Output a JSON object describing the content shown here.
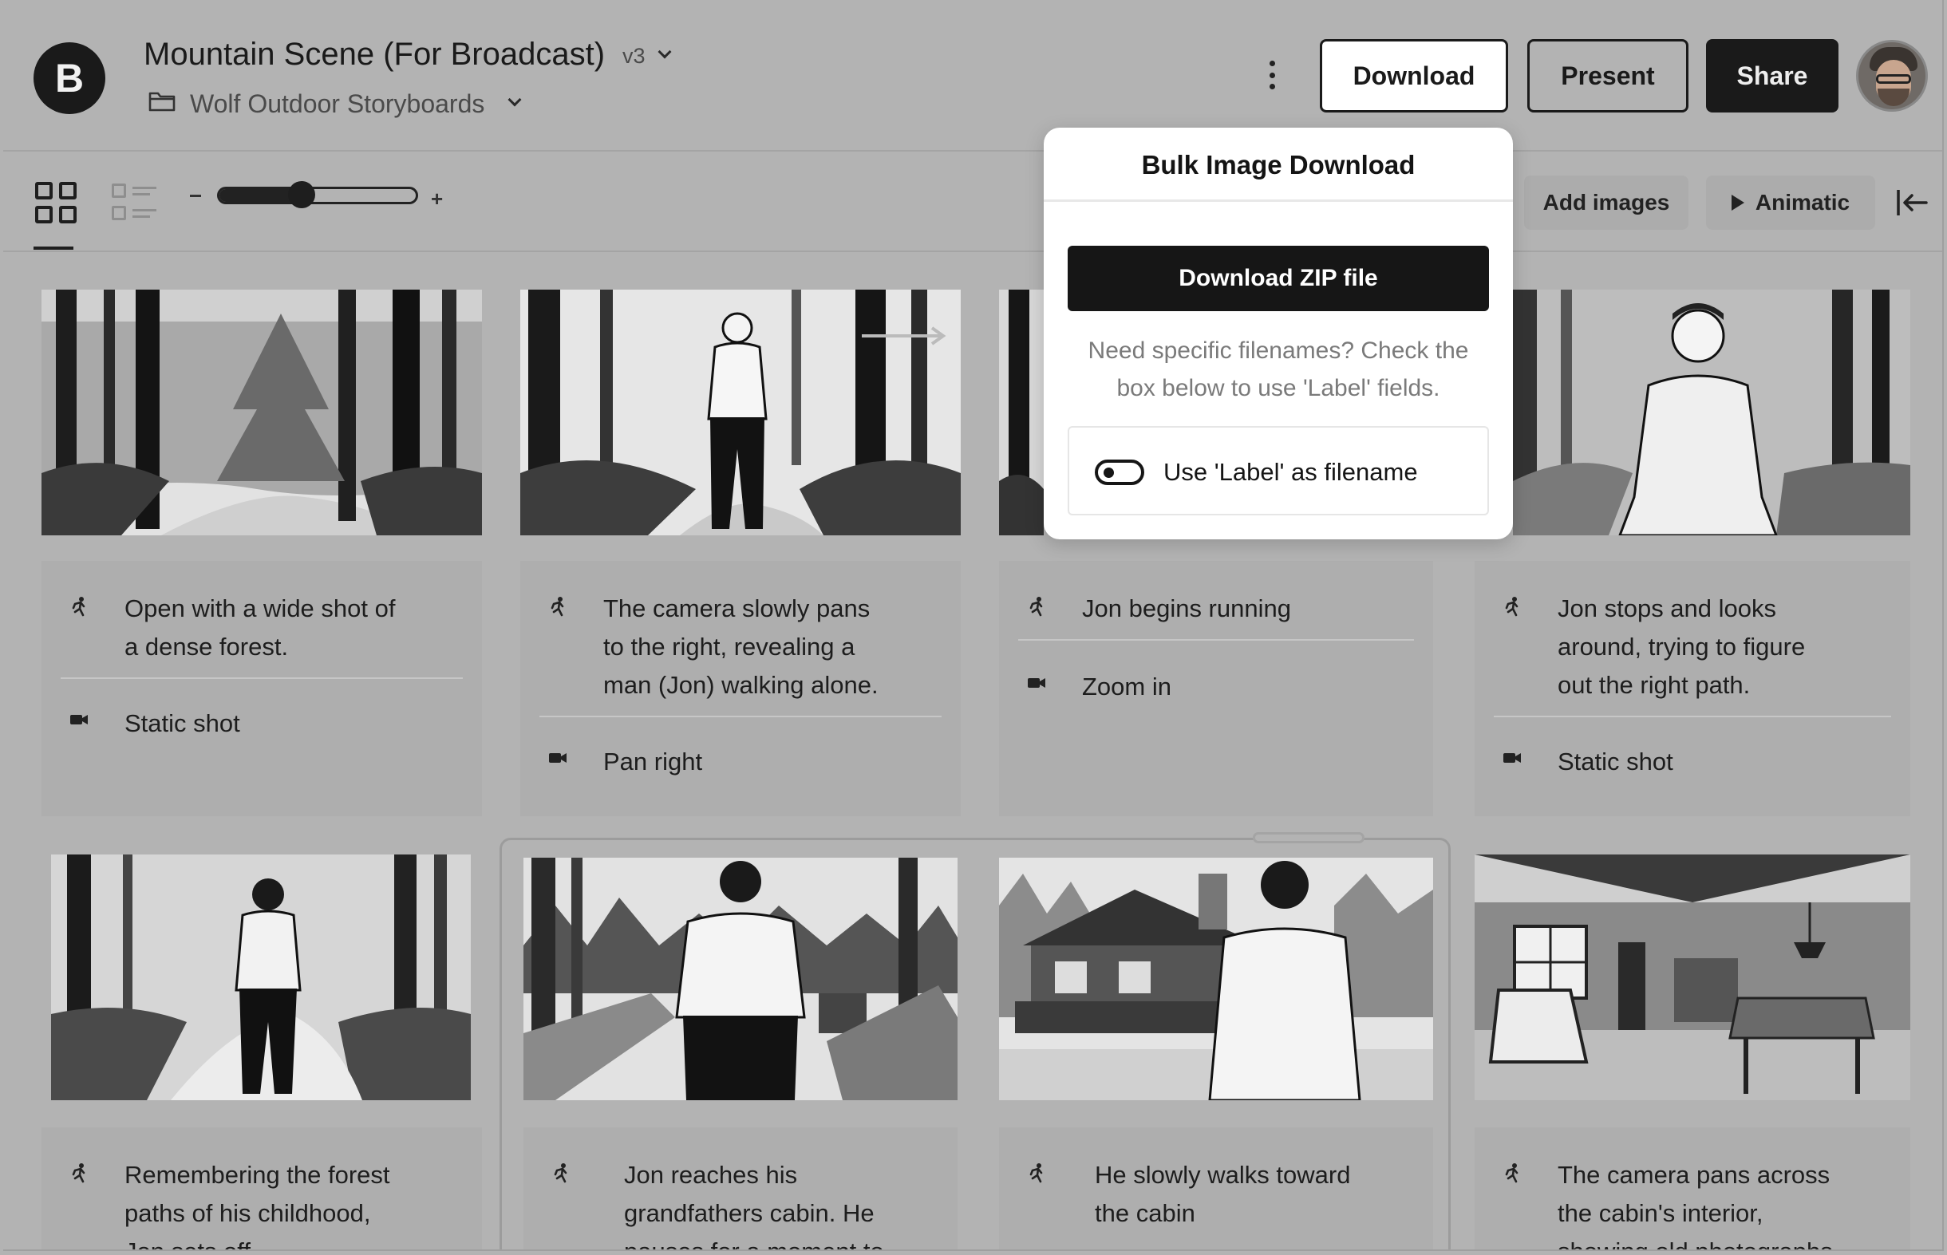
{
  "header": {
    "logo_letter": "B",
    "title": "Mountain Scene (For Broadcast)",
    "version": "v3",
    "folder": "Wolf Outdoor Storyboards",
    "buttons": {
      "download": "Download",
      "present": "Present",
      "share": "Share"
    }
  },
  "toolbar": {
    "zoom": {
      "minus": "−",
      "plus": "+",
      "value_fraction": 0.42
    },
    "add_images": "Add images",
    "animatic": "Animatic"
  },
  "popup": {
    "title": "Bulk Image Download",
    "zip_button": "Download ZIP file",
    "help_line1": "Need specific filenames? Check the",
    "help_line2": "box below to use 'Label' fields.",
    "label_option": "Use 'Label' as filename",
    "label_option_enabled": false
  },
  "frames": [
    {
      "action": [
        "Open with a wide shot of",
        "a dense forest."
      ],
      "camera": "Static shot",
      "image": "forest-wide"
    },
    {
      "action": [
        "The camera slowly pans",
        "to the right, revealing a",
        "man (Jon) walking alone."
      ],
      "camera": "Pan right",
      "image": "man-walking-forest"
    },
    {
      "action": [
        "Jon begins running"
      ],
      "camera": "Zoom in",
      "image": "forest-zoom"
    },
    {
      "action": [
        "Jon stops and looks",
        "around, trying to figure",
        "out the right path."
      ],
      "camera": "Static shot",
      "image": "man-portrait-forest"
    },
    {
      "action": [
        "Remembering the forest",
        "paths of his childhood,",
        "Jon sets off..."
      ],
      "image": "man-back-path"
    },
    {
      "action": [
        "Jon reaches his",
        "grandfathers cabin. He",
        "pauses for a moment to..."
      ],
      "image": "man-back-ruins"
    },
    {
      "action": [
        "He slowly walks toward",
        "the cabin"
      ],
      "image": "man-back-cabin"
    },
    {
      "action": [
        "The camera pans across",
        "the cabin's interior,",
        "showing old photographs..."
      ],
      "image": "cabin-interior"
    }
  ],
  "icons": {
    "action": "running-person-icon",
    "camera": "video-camera-icon",
    "more": "kebab-menu-icon",
    "collapse": "collapse-panel-icon"
  }
}
